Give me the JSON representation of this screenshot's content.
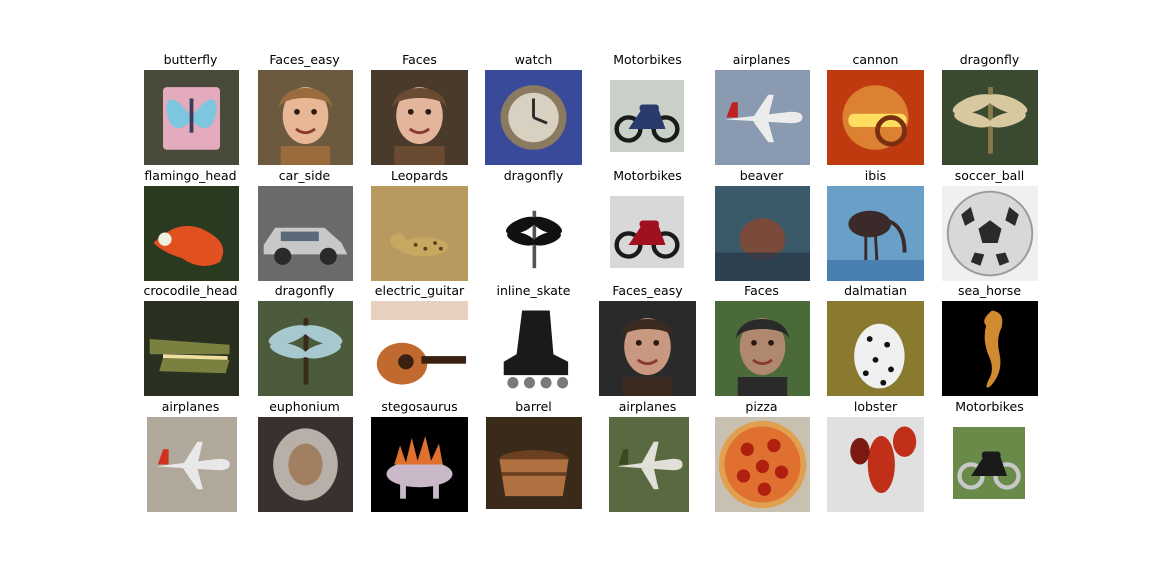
{
  "figure": {
    "rows": 4,
    "cols": 8,
    "images": [
      {
        "label": "butterfly",
        "icon": "butterfly-icon",
        "bg": "#4a4a3a",
        "fg": "#e4aabd",
        "accent": "#7cc6e0"
      },
      {
        "label": "Faces_easy",
        "icon": "face-icon",
        "bg": "#6b5a3e",
        "fg": "#e8b896",
        "accent": "#9a6b3c"
      },
      {
        "label": "Faces",
        "icon": "face-icon",
        "bg": "#4a3a2c",
        "fg": "#e3b59a",
        "accent": "#6b4a32"
      },
      {
        "label": "watch",
        "icon": "watch-icon",
        "bg": "#3a4a9a",
        "fg": "#8a7a60",
        "accent": "#d8d0c0"
      },
      {
        "label": "Motorbikes",
        "icon": "motorbike-icon",
        "bg": "#c8d0c8",
        "fg": "#2a3a6a",
        "accent": "#1a1a1a"
      },
      {
        "label": "airplanes",
        "icon": "airplane-icon",
        "bg": "#8a9ab0",
        "fg": "#ececec",
        "accent": "#c02020"
      },
      {
        "label": "cannon",
        "icon": "cannon-icon",
        "bg": "#c03a10",
        "fg": "#e8a040",
        "accent": "#ffdd60"
      },
      {
        "label": "dragonfly",
        "icon": "dragonfly-icon",
        "bg": "#3a4a30",
        "fg": "#d8c8a0",
        "accent": "#8a7a4a"
      },
      {
        "label": "flamingo_head",
        "icon": "flamingo-icon",
        "bg": "#2a3a20",
        "fg": "#e05020",
        "accent": "#f0f0e0"
      },
      {
        "label": "car_side",
        "icon": "car-icon",
        "bg": "#6a6a6a",
        "fg": "#c8c8c8",
        "accent": "#2a2a2a"
      },
      {
        "label": "Leopards",
        "icon": "leopard-icon",
        "bg": "#b89a60",
        "fg": "#c8a860",
        "accent": "#5a4020"
      },
      {
        "label": "dragonfly",
        "icon": "dragonfly-icon",
        "bg": "#ffffff",
        "fg": "#111111",
        "accent": "#555555"
      },
      {
        "label": "Motorbikes",
        "icon": "motorbike-icon",
        "bg": "#d8d8d8",
        "fg": "#a01020",
        "accent": "#1a1a1a"
      },
      {
        "label": "beaver",
        "icon": "beaver-icon",
        "bg": "#3a5a6a",
        "fg": "#7a4a3a",
        "accent": "#2a3a4a"
      },
      {
        "label": "ibis",
        "icon": "ibis-icon",
        "bg": "#6aa0c8",
        "fg": "#3a2a2a",
        "accent": "#4a80b0"
      },
      {
        "label": "soccer_ball",
        "icon": "soccer-ball-icon",
        "bg": "#f0f0f0",
        "fg": "#d8d8d8",
        "accent": "#2a2a2a"
      },
      {
        "label": "crocodile_head",
        "icon": "crocodile-icon",
        "bg": "#2a3020",
        "fg": "#7a8040",
        "accent": "#f0e0a0"
      },
      {
        "label": "dragonfly",
        "icon": "dragonfly-icon",
        "bg": "#4a5a3a",
        "fg": "#a8c8d0",
        "accent": "#3a2a1a"
      },
      {
        "label": "electric_guitar",
        "icon": "guitar-icon",
        "bg": "#ffffff",
        "fg": "#c06a30",
        "accent": "#3a2010"
      },
      {
        "label": "inline_skate",
        "icon": "skate-icon",
        "bg": "#ffffff",
        "fg": "#1a1a1a",
        "accent": "#7a7a7a"
      },
      {
        "label": "Faces_easy",
        "icon": "face-icon",
        "bg": "#2a2a2a",
        "fg": "#c89880",
        "accent": "#3a2a20"
      },
      {
        "label": "Faces",
        "icon": "face-icon",
        "bg": "#4a6a3a",
        "fg": "#b08870",
        "accent": "#2a2a2a"
      },
      {
        "label": "dalmatian",
        "icon": "dalmatian-icon",
        "bg": "#8a7a30",
        "fg": "#f0f0f0",
        "accent": "#111111"
      },
      {
        "label": "sea_horse",
        "icon": "seahorse-icon",
        "bg": "#000000",
        "fg": "#d08a30",
        "accent": "#7a4a10"
      },
      {
        "label": "airplanes",
        "icon": "airplane-icon",
        "bg": "#b0a89a",
        "fg": "#e8e8e8",
        "accent": "#d03020"
      },
      {
        "label": "euphonium",
        "icon": "euphonium-icon",
        "bg": "#3a3030",
        "fg": "#b8b0a8",
        "accent": "#a08060"
      },
      {
        "label": "stegosaurus",
        "icon": "stegosaurus-icon",
        "bg": "#000000",
        "fg": "#c8b8c8",
        "accent": "#e07030"
      },
      {
        "label": "barrel",
        "icon": "barrel-icon",
        "bg": "#3a2a1a",
        "fg": "#b07040",
        "accent": "#6a4020"
      },
      {
        "label": "airplanes",
        "icon": "airplane-icon",
        "bg": "#5a6a40",
        "fg": "#e0e0d8",
        "accent": "#3a4a20"
      },
      {
        "label": "pizza",
        "icon": "pizza-icon",
        "bg": "#c8c0b0",
        "fg": "#e0a050",
        "accent": "#b02010"
      },
      {
        "label": "lobster",
        "icon": "lobster-icon",
        "bg": "#e0e0e0",
        "fg": "#c03018",
        "accent": "#7a1a10"
      },
      {
        "label": "Motorbikes",
        "icon": "motorbike-icon",
        "bg": "#6a8a4a",
        "fg": "#1a1a1a",
        "accent": "#c8c8c8"
      }
    ]
  }
}
